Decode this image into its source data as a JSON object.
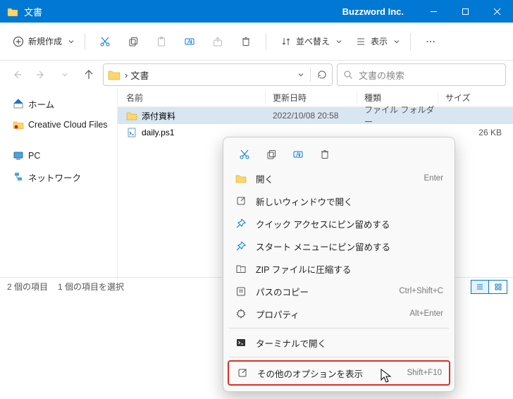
{
  "title_bar": {
    "title": "文書",
    "company": "Buzzword Inc."
  },
  "toolbar": {
    "new_label": "新規作成",
    "sort_label": "並べ替え",
    "view_label": "表示"
  },
  "nav": {
    "crumb": "文書",
    "search_placeholder": "文書の検索"
  },
  "sidebar": {
    "home": "ホーム",
    "creative_cloud": "Creative Cloud Files",
    "pc": "PC",
    "network": "ネットワーク"
  },
  "columns": {
    "name": "名前",
    "date": "更新日時",
    "type": "種類",
    "size": "サイズ"
  },
  "rows": [
    {
      "name": "添付資料",
      "date": "2022/10/08 20:58",
      "type": "ファイル フォルダー",
      "size": ""
    },
    {
      "name": "daily.ps1",
      "date": "",
      "type": "",
      "size": "26 KB"
    }
  ],
  "status": {
    "count": "2 個の項目",
    "selection": "1 個の項目を選択"
  },
  "context_menu": {
    "open": "開く",
    "open_shortcut": "Enter",
    "new_window": "新しいウィンドウで開く",
    "pin_quick": "クイック アクセスにピン留めする",
    "pin_start": "スタート メニューにピン留めする",
    "zip": "ZIP ファイルに圧縮する",
    "copy_path": "パスのコピー",
    "copy_path_shortcut": "Ctrl+Shift+C",
    "properties": "プロパティ",
    "properties_shortcut": "Alt+Enter",
    "terminal": "ターミナルで開く",
    "more_options": "その他のオプションを表示",
    "more_options_shortcut": "Shift+F10"
  }
}
